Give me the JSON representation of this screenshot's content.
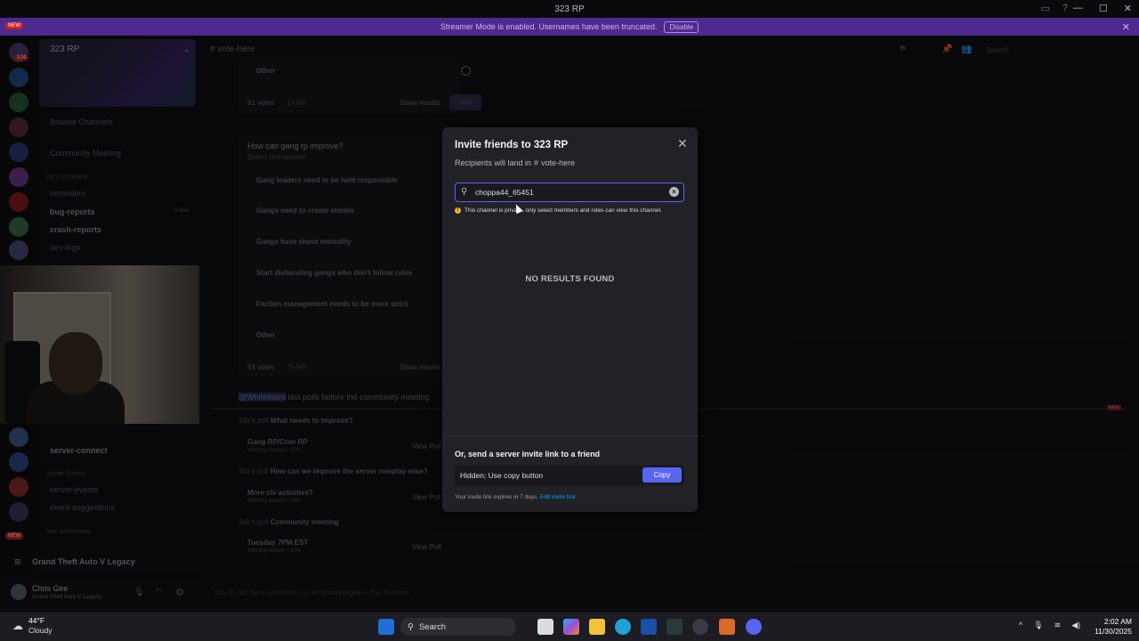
{
  "window": {
    "title": "323 RP"
  },
  "banner": {
    "text": "Streamer Mode is enabled. Usernames have been truncated.",
    "button": "Disable"
  },
  "sidebar": {
    "server_name": "323 RP",
    "channels": [
      {
        "label": "Browse Channels"
      },
      {
        "label": "Community Meeting"
      },
      {
        "label": "reminders"
      },
      {
        "label": "bug-reports",
        "badge": "6 New"
      },
      {
        "label": "crash-reports"
      },
      {
        "label": "dev-logs"
      },
      {
        "label": "server-connect"
      },
      {
        "label": "server-events"
      },
      {
        "label": "event-suggestions"
      }
    ],
    "categories": {
      "dev_corner": "DEV CORNER",
      "server_events": "Server Events",
      "non_whitelisted": "Non Whitelisted"
    },
    "game": "Grand Theft Auto V Legacy",
    "user": {
      "name": "Chris Gee",
      "status": "Grand Theft Auto V Legacy"
    }
  },
  "rail": {
    "new_label": "NEW",
    "badges": [
      "124",
      "2",
      "12",
      "9",
      "59",
      "4"
    ]
  },
  "chat": {
    "channel": "vote-here",
    "search_placeholder": "Search",
    "poll1": {
      "option": "Other",
      "votes": "61 votes",
      "time": "1h left",
      "show": "Show results",
      "vote": "Vote"
    },
    "poll2": {
      "question": "How can gang rp improve?",
      "hint": "Select one answer",
      "options": [
        "Gang leaders need to be held responsible",
        "Gangs need to create stories",
        "Gangs have shoot mentality",
        "Start disbanding gangs who don't follow rules",
        "Faction management needs to be more strict",
        "Other"
      ],
      "votes": "64 votes",
      "time": "7h left",
      "show": "Show results"
    },
    "message": {
      "mention": "@Whitelisted",
      "text": "last polls before the community meeting"
    },
    "closed": [
      {
        "poll": "What needs to improve?",
        "winner": "Gang RP/Crim RP",
        "sub": "Winning answer • 45%",
        "view": "View Poll"
      },
      {
        "poll": "How can we improve the server roleplay wise?",
        "winner": "More civ activities?",
        "sub": "Winning answer • 28%",
        "view": "View Poll"
      },
      {
        "poll": "Community meeting",
        "winner": "Tuesday 7PM EST",
        "sub": "Winning answer • 60%",
        "view": "View Poll"
      }
    ],
    "input_placeholder": "You do not have permission to send messages in this channel."
  },
  "modal": {
    "title": "Invite friends to 323 RP",
    "subtitle_prefix": "Recipients will land in",
    "subtitle_channel": "vote-here",
    "search_value": "choppa44_65451",
    "warning": "This channel is private, only select members and roles can view this channel.",
    "no_results": "NO RESULTS FOUND",
    "send_label": "Or, send a server invite link to a friend",
    "link_value": "Hidden; Use copy button",
    "copy_label": "Copy",
    "expires_text": "Your invite link expires in 7 days.",
    "edit_link": "Edit invite link."
  },
  "taskbar": {
    "weather": {
      "temp": "44°F",
      "condition": "Cloudy"
    },
    "search": "Search",
    "time": "2:02 AM",
    "date": "11/30/2025"
  }
}
